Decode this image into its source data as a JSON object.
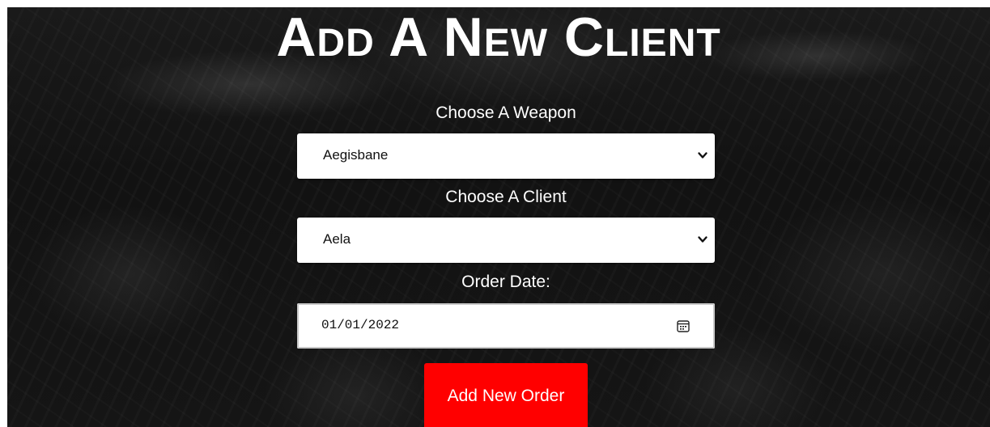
{
  "header": {
    "title": "Add A New Client"
  },
  "form": {
    "weapon": {
      "label": "Choose A Weapon",
      "selected": "Aegisbane"
    },
    "client": {
      "label": "Choose A Client",
      "selected": "Aela"
    },
    "order_date": {
      "label": "Order Date:",
      "value": "01/01/2022"
    },
    "submit_label": "Add New Order"
  },
  "icons": {
    "select_arrow": "chevron-down-icon",
    "date_picker": "calendar-icon"
  },
  "colors": {
    "button_bg": "#ff0000",
    "button_text": "#ffffff",
    "text": "#ffffff",
    "background": "#141414"
  }
}
